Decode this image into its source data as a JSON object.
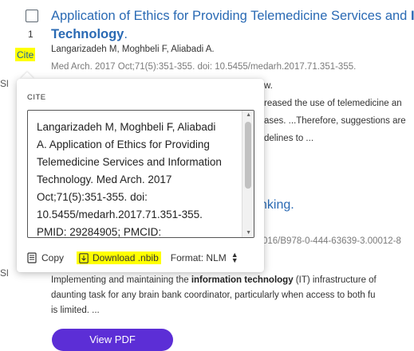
{
  "result": {
    "number": "1",
    "cite_button": "Cite",
    "title_start": "Application of Ethics for Providing Telemedicine Services and ",
    "title_bold_cut": "In",
    "title_line2": "Technology",
    "title_line2_suffix": ".",
    "authors": "Langarizadeh M, Moghbeli F, Aliabadi A.",
    "citation": "Med Arch. 2017 Oct;71(5):351-355. doi: 10.5455/medarh.2017.71.351-355.",
    "share_cut": "Sl",
    "fragments": [
      "w.",
      "reased the use of telemedicine an",
      "ases. ...Therefore, suggestions are",
      "delines to ..."
    ]
  },
  "result2": {
    "title_cut": "nking.",
    "doi_cut": "016/B978-0-444-63639-3.00012-8",
    "share_cut": "Sl",
    "snippet_line1_pre": "Implementing and maintaining the ",
    "snippet_bold": "information technology",
    "snippet_line1_post": " (IT) infrastructure of",
    "snippet_line2": "daunting task for any brain bank coordinator, particularly when access to both fu",
    "snippet_line3": "is limited. ...",
    "view_pdf": "View PDF"
  },
  "cite_popup": {
    "header": "CITE",
    "citation_text": "Langarizadeh M, Moghbeli F, Aliabadi\nA. Application of Ethics for Providing\nTelemedicine Services and Information\nTechnology. Med Arch. 2017\nOct;71(5):351-355. doi:\n10.5455/medarh.2017.71.351-355.\nPMID: 29284905; PMCID:",
    "copy_label": "Copy",
    "download_label": "Download .nbib",
    "format_label": "Format: NLM"
  },
  "colors": {
    "link": "#2a6ab4",
    "highlight": "#ffff00",
    "button": "#5c2ed6"
  },
  "icons": [
    "checkbox-icon",
    "copy-icon",
    "download-icon",
    "updown-icon"
  ]
}
